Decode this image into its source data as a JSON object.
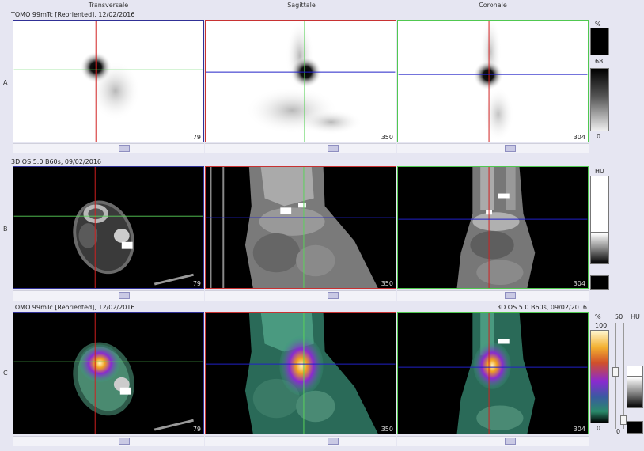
{
  "columns": [
    "Transversale",
    "Sagittale",
    "Coronale"
  ],
  "rows": [
    {
      "label": "A",
      "title": "TOMO 99mTc [Reoriented], 12/02/2016",
      "slices": [
        "79",
        "350",
        "304"
      ]
    },
    {
      "label": "B",
      "title": "3D  OS  5.0  B60s, 09/02/2016",
      "slices": [
        "79",
        "350",
        "304"
      ]
    },
    {
      "label": "C",
      "title": "TOMO 99mTc [Reoriented], 12/02/2016",
      "title_right": "3D  OS  5.0  B60s, 09/02/2016",
      "slices": [
        "79",
        "350",
        "304"
      ]
    }
  ],
  "colorbars": {
    "a": {
      "unit": "%",
      "max": "68",
      "min": "0"
    },
    "b": {
      "unit": "HU"
    },
    "c": {
      "unit": "%",
      "max": "100",
      "min": "0",
      "mix": "50",
      "unit2": "HU",
      "min2": "0"
    }
  },
  "colors": {
    "transversal_frame": "#303096",
    "sagittal_frame": "#c83232",
    "coronal_frame": "#50c850",
    "crosshair_vertical": "#d02020",
    "crosshair_horizontal_green": "#5ad25a",
    "crosshair_horizontal_blue": "#2020c8"
  }
}
